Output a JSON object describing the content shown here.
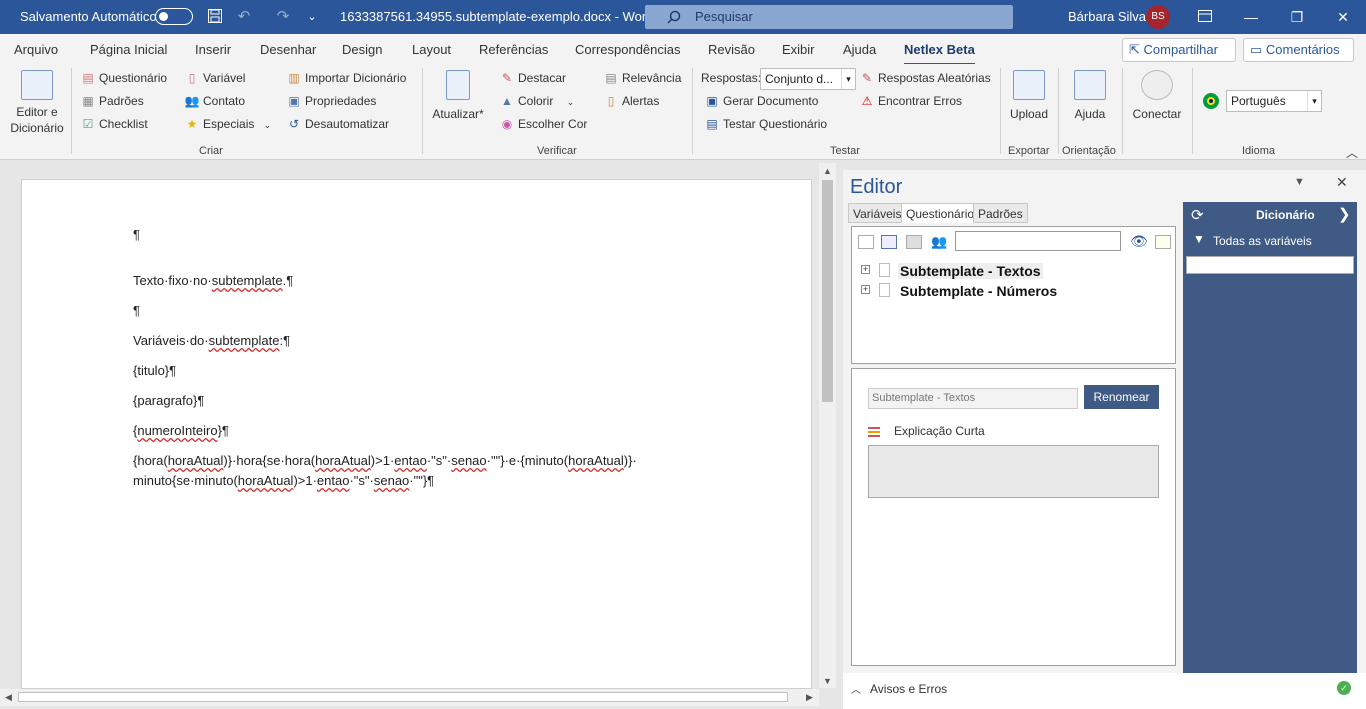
{
  "titlebar": {
    "autosave_label": "Salvamento Automático",
    "doc_title": "1633387561.34955.subtemplate-exemplo.docx  -  Word",
    "search_placeholder": "Pesquisar",
    "user_name": "Bárbara Silva",
    "user_initials": "BS"
  },
  "menu": [
    "Arquivo",
    "Página Inicial",
    "Inserir",
    "Desenhar",
    "Design",
    "Layout",
    "Referências",
    "Correspondências",
    "Revisão",
    "Exibir",
    "Ajuda",
    "Netlex Beta"
  ],
  "header_buttons": {
    "share": "Compartilhar",
    "comments": "Comentários"
  },
  "ribbon": {
    "editor_dict": [
      "Editor e",
      "Dicionário"
    ],
    "criar": {
      "col1": [
        "Questionário",
        "Padrões",
        "Checklist"
      ],
      "col2": [
        "Variável",
        "Contato",
        "Especiais"
      ],
      "col3": [
        "Importar Dicionário",
        "Propriedades",
        "Desautomatizar"
      ],
      "label": "Criar"
    },
    "atualizar": "Atualizar*",
    "verificar": {
      "col1": [
        "Destacar",
        "Colorir",
        "Escolher Cor"
      ],
      "col2": [
        "Relevância",
        "Alertas"
      ],
      "label": "Verificar"
    },
    "testar": {
      "respostas_label": "Respostas:",
      "respostas_value": "Conjunto d...",
      "random": "Respostas Aleatórias",
      "find_errors": "Encontrar Erros",
      "generate": "Gerar Documento",
      "test": "Testar Questionário",
      "label": "Testar"
    },
    "upload": "Upload",
    "exportar": "Exportar",
    "ajuda": "Ajuda",
    "orientacao": "Orientação",
    "conectar": "Conectar",
    "idioma_value": "Português",
    "idioma": "Idioma"
  },
  "document": {
    "lines": [
      "¶",
      "Texto·fixo·no·",
      "subtemplate",
      ".¶",
      "¶",
      "Variáveis·do·",
      "subtemplate",
      ":¶",
      "{titulo}¶",
      "{paragrafo}¶",
      "{",
      "numeroInteiro",
      "}¶",
      "{hora(",
      "horaAtual",
      ")}·hora{se·hora(",
      "horaAtual",
      ")>1·",
      "entao",
      "·\"s\"·",
      "senao",
      "·\"\"}·e·{minuto(",
      "horaAtual",
      ")}·",
      "minuto{se·minuto(",
      "horaAtual",
      ")>1·",
      "entao",
      "·\"s\"·",
      "senao",
      "·\"\"}¶"
    ]
  },
  "editor": {
    "title": "Editor",
    "tabs": [
      "Variáveis",
      "Questionário",
      "Padrões"
    ],
    "tree": [
      "Subtemplate - Textos",
      "Subtemplate - Números"
    ],
    "name_value": "Subtemplate - Textos",
    "rename": "Renomear",
    "short_expl": "Explicação Curta",
    "warnings": "Avisos e Erros"
  },
  "dictionary": {
    "title": "Dicionário",
    "filter": "Todas as variáveis"
  }
}
